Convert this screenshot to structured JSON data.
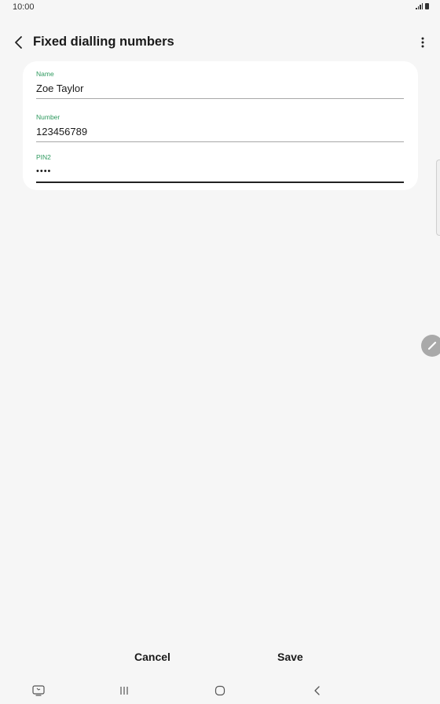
{
  "status_bar": {
    "time": "10:00"
  },
  "app_bar": {
    "title": "Fixed dialling numbers",
    "back_icon": "chevron-left-icon",
    "more_icon": "more-vertical-icon"
  },
  "form": {
    "fields": [
      {
        "label": "Name",
        "value": "Zoe Taylor"
      },
      {
        "label": "Number",
        "value": "123456789"
      },
      {
        "label": "PIN2",
        "value": "••••"
      }
    ]
  },
  "actions": {
    "cancel_label": "Cancel",
    "save_label": "Save"
  },
  "nav_bar": {
    "icons": [
      "recent-apps-screenshot-icon",
      "recents-icon",
      "home-icon",
      "back-icon"
    ]
  },
  "colors": {
    "accent": "#2f9a5f",
    "background": "#f6f6f6",
    "card": "#ffffff"
  }
}
